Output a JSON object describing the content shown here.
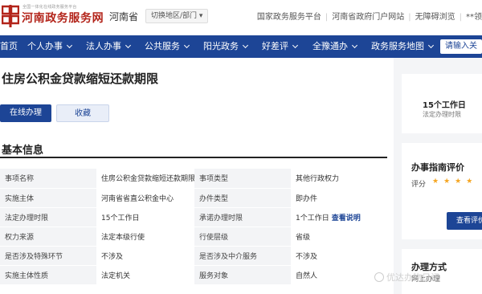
{
  "header": {
    "logo_small": "全国一体化在线政务服务平台",
    "logo_big": "河南政务服务网",
    "region": "河南省",
    "switch_label": "切换地区/部门 ▾",
    "links": [
      "国家政务服务平台",
      "河南省政府门户网站",
      "无障碍浏览",
      "**领"
    ]
  },
  "nav": {
    "items": [
      "首页",
      "个人办事",
      "法人办事",
      "公共服务",
      "阳光政务",
      "好差评",
      "全豫通办",
      "政务服务地图"
    ],
    "login": "请输入关"
  },
  "main": {
    "title": "住房公积金贷款缩短还款期限",
    "btn_online": "在线办理",
    "btn_fav": "收藏",
    "section_title": "基本信息",
    "rows": [
      [
        "事项名称",
        "住房公积金贷款缩短还款期限",
        "事项类型",
        "其他行政权力"
      ],
      [
        "实施主体",
        "河南省省直公积金中心",
        "办件类型",
        "即办件"
      ],
      [
        "法定办理时限",
        "15个工作日",
        "承诺办理时限",
        "1个工作日"
      ],
      [
        "权力来源",
        "法定本级行使",
        "行使层级",
        "省级"
      ],
      [
        "是否涉及特殊环节",
        "不涉及",
        "是否涉及中介服务",
        "不涉及"
      ],
      [
        "实施主体性质",
        "法定机关",
        "服务对象",
        "自然人"
      ]
    ],
    "view_link": "查看说明"
  },
  "side": {
    "box1_main": "15个工作日",
    "box1_sub": "法定办理时限",
    "box2_title": "办事指南评价",
    "box2_score_label": "评分",
    "box2_stars": "★★★★",
    "box2_btn": "查看评价",
    "box3_title": "办理方式",
    "box3_sub": "网上办理"
  },
  "watermark": "优达办物日记",
  "colors": {
    "brand_blue": "#1d4596",
    "brand_red": "#b3241a",
    "star": "#f5a623"
  }
}
